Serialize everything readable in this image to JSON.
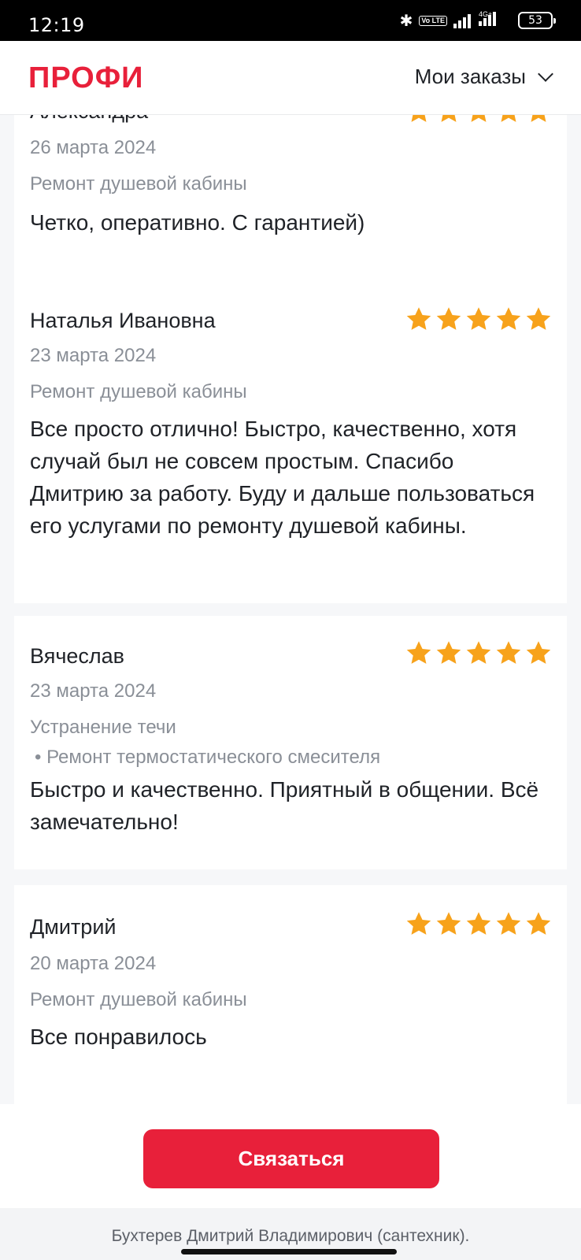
{
  "status_bar": {
    "time": "12:19",
    "volte": "Vo LTE",
    "network": "4G+",
    "battery": "53"
  },
  "header": {
    "logo": "ПРОФИ",
    "menu_label": "Мои заказы"
  },
  "reviews": [
    {
      "name": "Александра",
      "date": "26 марта 2024",
      "category": "Ремонт душевой кабины",
      "text": "Четко, оперативно. С гарантией)",
      "rating": 5
    },
    {
      "name": "Наталья Ивановна",
      "date": "23 марта 2024",
      "category": "Ремонт душевой кабины",
      "text": "Все просто отлично! Быстро, качественно, хотя случай был не совсем простым. Спасибо Дмитрию за работу. Буду и дальше пользоваться его услугами по ремонту душевой кабины.",
      "rating": 5
    },
    {
      "name": "Вячеслав",
      "date": "23 марта 2024",
      "category": "Устранение течи",
      "subcategory": "• Ремонт термостатического смесителя",
      "text": "Быстро и качественно. Приятный в общении. Всё замечательно!",
      "rating": 5
    },
    {
      "name": "Дмитрий",
      "date": "20 марта 2024",
      "category": "Ремонт душевой кабины",
      "text": "Все понравилось",
      "rating": 5
    }
  ],
  "cta": {
    "label": "Связаться"
  },
  "footer": {
    "name": "Бухтерев Дмитрий Владимирович (сантехник)."
  },
  "colors": {
    "brand": "#e8203a",
    "star": "#f7a21b",
    "muted_text": "#8a8f97"
  }
}
